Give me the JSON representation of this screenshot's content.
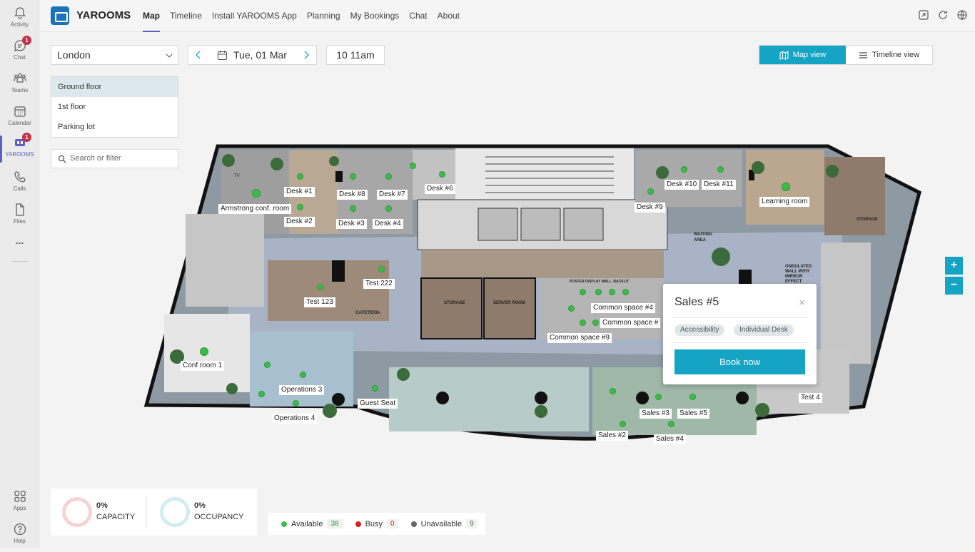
{
  "rail": {
    "items": [
      {
        "label": "Activity",
        "icon": "bell-icon"
      },
      {
        "label": "Chat",
        "icon": "chat-icon",
        "badge": "1"
      },
      {
        "label": "Teams",
        "icon": "teams-icon"
      },
      {
        "label": "Calendar",
        "icon": "calendar-icon"
      },
      {
        "label": "YAROOMS",
        "icon": "yarooms-icon",
        "badge": "1"
      },
      {
        "label": "Calls",
        "icon": "phone-icon"
      },
      {
        "label": "Files",
        "icon": "file-icon"
      },
      {
        "label": "...",
        "icon": "more-icon"
      }
    ],
    "bottom": [
      {
        "label": "Apps",
        "icon": "apps-icon"
      },
      {
        "label": "Help",
        "icon": "help-icon"
      }
    ],
    "accent": "#5b5fc7"
  },
  "header": {
    "app_name": "YAROOMS",
    "tabs": [
      "Map",
      "Timeline",
      "Install YAROOMS App",
      "Planning",
      "My Bookings",
      "Chat",
      "About"
    ],
    "active_tab": "Map"
  },
  "controls": {
    "location": "London",
    "date": "Tue, 01 Mar",
    "time": "10 11am",
    "view_map": "Map view",
    "view_timeline": "Timeline view",
    "accent": "#15a4c4"
  },
  "floors": [
    "Ground floor",
    "1st floor",
    "Parking lot"
  ],
  "selected_floor": "Ground floor",
  "search": {
    "placeholder": "Search or filter"
  },
  "map": {
    "labels": [
      "Desk #1",
      "Desk #2",
      "Desk #8",
      "Desk #7",
      "Desk #3",
      "Desk #4",
      "Desk #6",
      "Armstrong conf. room",
      "Desk #9",
      "Desk #10",
      "Desk #11",
      "Learning room",
      "Test 222",
      "Test 123",
      "Common space #4",
      "Common space #",
      "Common space #9",
      "Conf room 1",
      "Operations 3",
      "Operations 4",
      "Guest Seat",
      "Sales #3",
      "Sales #5",
      "Sales #2",
      "Sales #4",
      "Test 4"
    ],
    "printed_text": {
      "cafeteria": "CAFETERIA",
      "storage": "STORAGE",
      "server_room": "SERVER ROOM",
      "storage2": "STORAGE",
      "waiting": "WAITING",
      "area": "AREA",
      "poster": "POSTER DISPLAY WALL, BACKLIT",
      "ondulated1": "ONDULATED",
      "ondulated2": "WALL WITH",
      "ondulated3": "MIRROR",
      "ondulated4": "EFFECT",
      "tv": "TV"
    }
  },
  "zoom": {
    "in": "+",
    "out": "−"
  },
  "popup": {
    "title": "Sales #5",
    "close": "×",
    "tags": [
      "Accessibility",
      "Individual Desk"
    ],
    "book": "Book now"
  },
  "stats": {
    "capacity_value": "0%",
    "capacity_label": "CAPACITY",
    "occupancy_value": "0%",
    "occupancy_label": "OCCUPANCY"
  },
  "legend": {
    "available_label": "Available",
    "available_count": "38",
    "busy_label": "Busy",
    "busy_count": "0",
    "unavailable_label": "Unavailable",
    "unavailable_count": "9",
    "available_color": "#3dbb48",
    "busy_color": "#e02020",
    "unavailable_color": "#666666"
  }
}
